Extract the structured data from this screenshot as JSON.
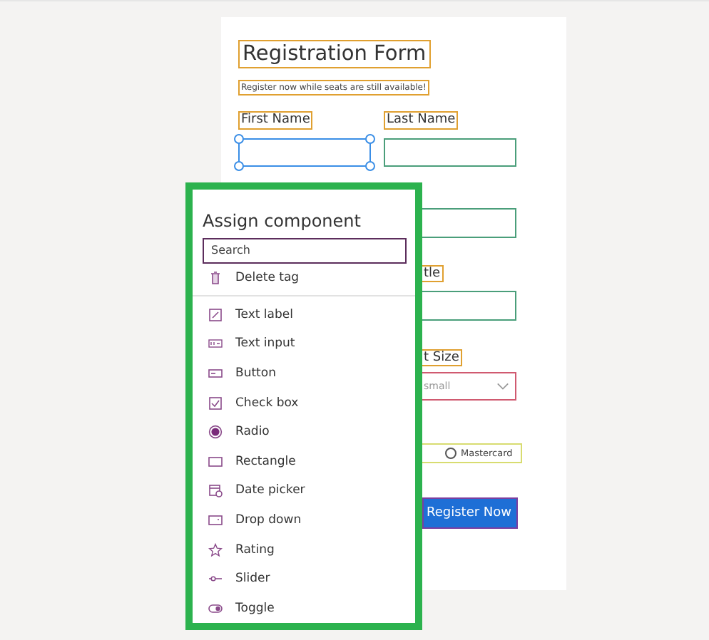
{
  "form": {
    "title": "Registration Form",
    "subtitle": "Register now while seats are still available!",
    "name_fields": [
      {
        "label": "First Name",
        "selected": true
      },
      {
        "label": "Last Name",
        "selected": false
      }
    ],
    "covered_rows": [
      {
        "kind": "input"
      },
      {
        "kind": "label",
        "text": "tle"
      },
      {
        "kind": "input"
      },
      {
        "kind": "label",
        "text": "t Size"
      },
      {
        "kind": "dropdown",
        "value": "small"
      },
      {
        "kind": "radio",
        "option": "Mastercard",
        "checked": false
      },
      {
        "kind": "button",
        "text": "Register Now"
      }
    ]
  },
  "popup": {
    "title": "Assign component",
    "search": {
      "placeholder": "Search"
    },
    "delete": {
      "label": "Delete tag"
    },
    "components": [
      {
        "kind": "text-label",
        "label": "Text label"
      },
      {
        "kind": "text-input",
        "label": "Text input"
      },
      {
        "kind": "button",
        "label": "Button"
      },
      {
        "kind": "check-box",
        "label": "Check box"
      },
      {
        "kind": "radio",
        "label": "Radio"
      },
      {
        "kind": "rectangle",
        "label": "Rectangle"
      },
      {
        "kind": "date-picker",
        "label": "Date picker"
      },
      {
        "kind": "drop-down",
        "label": "Drop down"
      },
      {
        "kind": "rating",
        "label": "Rating"
      },
      {
        "kind": "slider",
        "label": "Slider"
      },
      {
        "kind": "toggle",
        "label": "Toggle"
      }
    ]
  }
}
